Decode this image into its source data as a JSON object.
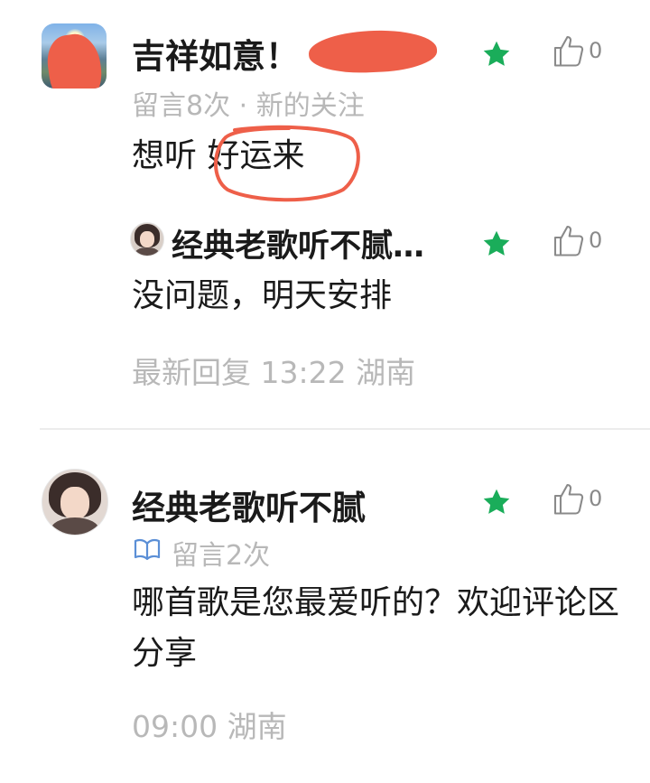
{
  "comments": [
    {
      "user": "吉祥如意！",
      "meta": "留言8次 · 新的关注",
      "content": "想听 好运来",
      "likes": "0",
      "reply": {
        "user": "经典老歌听不腻…",
        "content": "没问题，明天安排",
        "time_text": "最新回复 13:22  湖南",
        "likes": "0"
      }
    },
    {
      "user": "经典老歌听不腻",
      "meta": "留言2次",
      "content": "哪首歌是您最爱听的？欢迎评论区分享",
      "time_text": "09:00  湖南",
      "likes": "0"
    }
  ],
  "colors": {
    "star": "#1aad5a",
    "annotation": "#ee5f49",
    "muted_text": "#b8b8b8",
    "book_icon": "#5b8fd6"
  },
  "icons": [
    "star-icon",
    "thumbs-up-icon",
    "book-icon"
  ]
}
